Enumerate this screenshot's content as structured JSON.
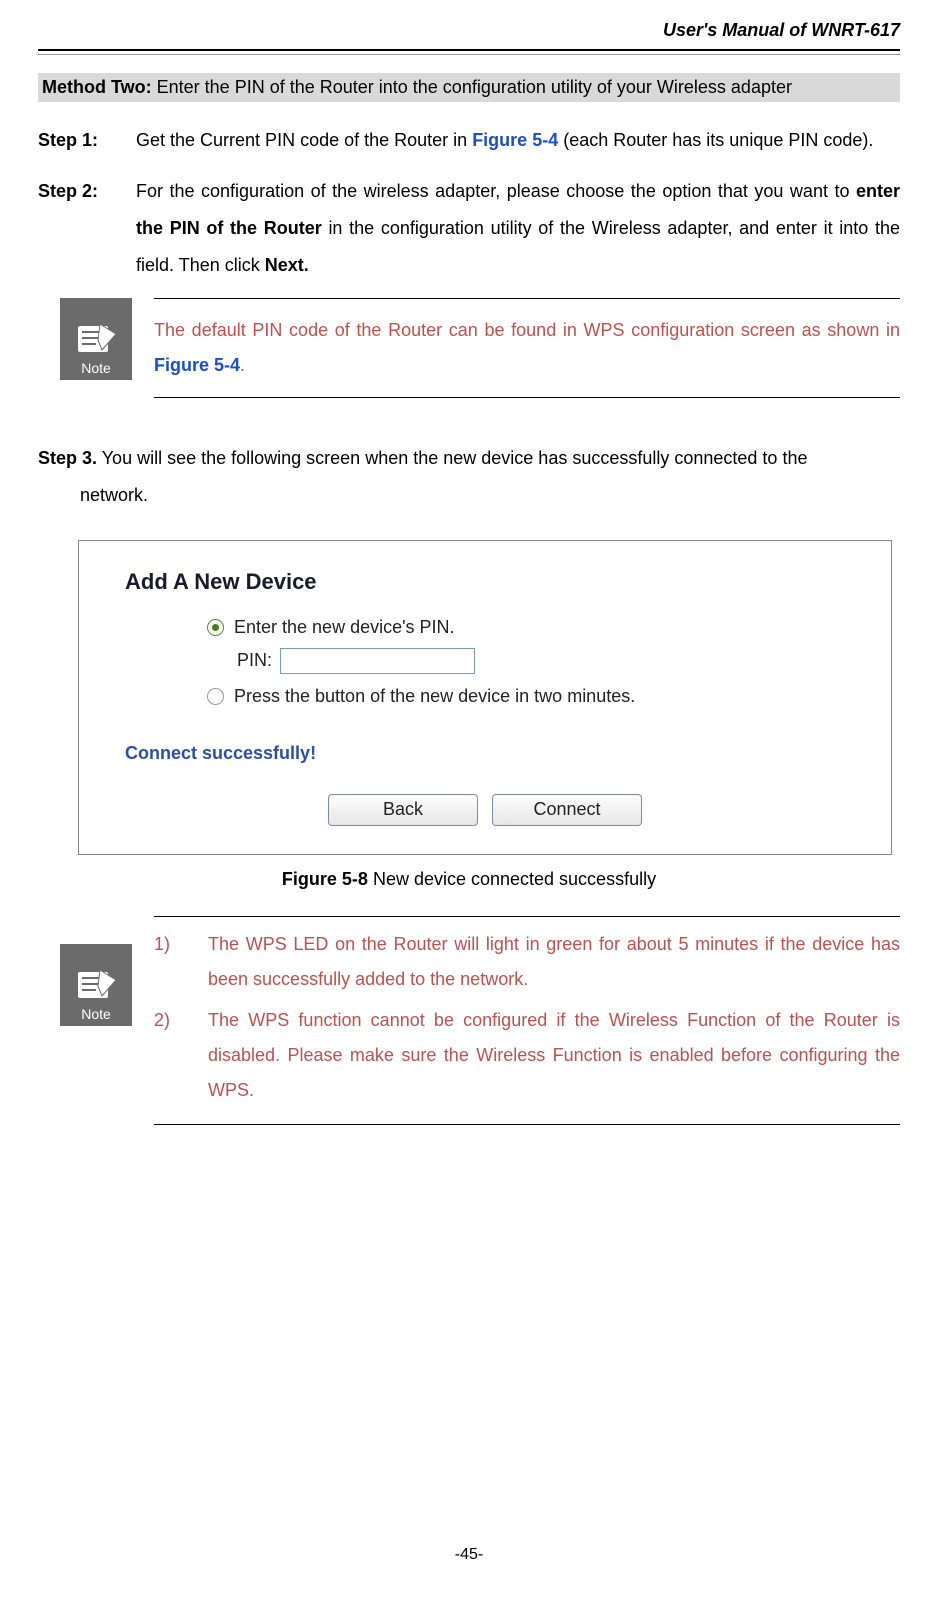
{
  "header": {
    "title": "User's Manual of WNRT-617"
  },
  "method": {
    "prefix": "Method Two:",
    "text": " Enter the PIN of the Router into the configuration utility of your Wireless adapter"
  },
  "step1": {
    "label": "Step 1:",
    "before": "Get the Current PIN code of the Router in ",
    "figref": "Figure 5-4",
    "after": " (each Router has its unique PIN code)."
  },
  "step2": {
    "label": "Step 2:",
    "p1": "For the configuration of the wireless adapter, please choose the option that you want to ",
    "bold1": "enter the PIN of the Router",
    "p2": " in the configuration utility of the Wireless adapter, and enter it into the field. Then click ",
    "bold2": "Next."
  },
  "note1": {
    "iconLabel": "Note",
    "t1": "The default PIN code of the Router can be found in WPS configuration screen as shown in ",
    "figref": "Figure 5-4",
    "t2": "."
  },
  "step3": {
    "label": "Step 3.",
    "body": "  You will see the following screen when the new device has successfully connected to the",
    "line2": "network."
  },
  "figure": {
    "title": "Add A New Device",
    "opt1": "Enter the new device's PIN.",
    "pinLabel": "PIN:",
    "opt2": "Press the button of the new device in two minutes.",
    "connect": "Connect successfully!",
    "backBtn": "Back",
    "connectBtn": "Connect"
  },
  "caption": {
    "bold": "Figure 5-8",
    "rest": "    New device connected successfully"
  },
  "note2": {
    "iconLabel": "Note",
    "n1num": "1)",
    "n1": "The WPS LED on the Router will light in green for about 5 minutes if the device has been successfully added to the network.",
    "n2num": "2)",
    "n2": "The WPS function cannot be configured if the Wireless Function of the Router is disabled. Please make sure the Wireless Function is enabled before configuring the WPS."
  },
  "pageNum": "-45-"
}
